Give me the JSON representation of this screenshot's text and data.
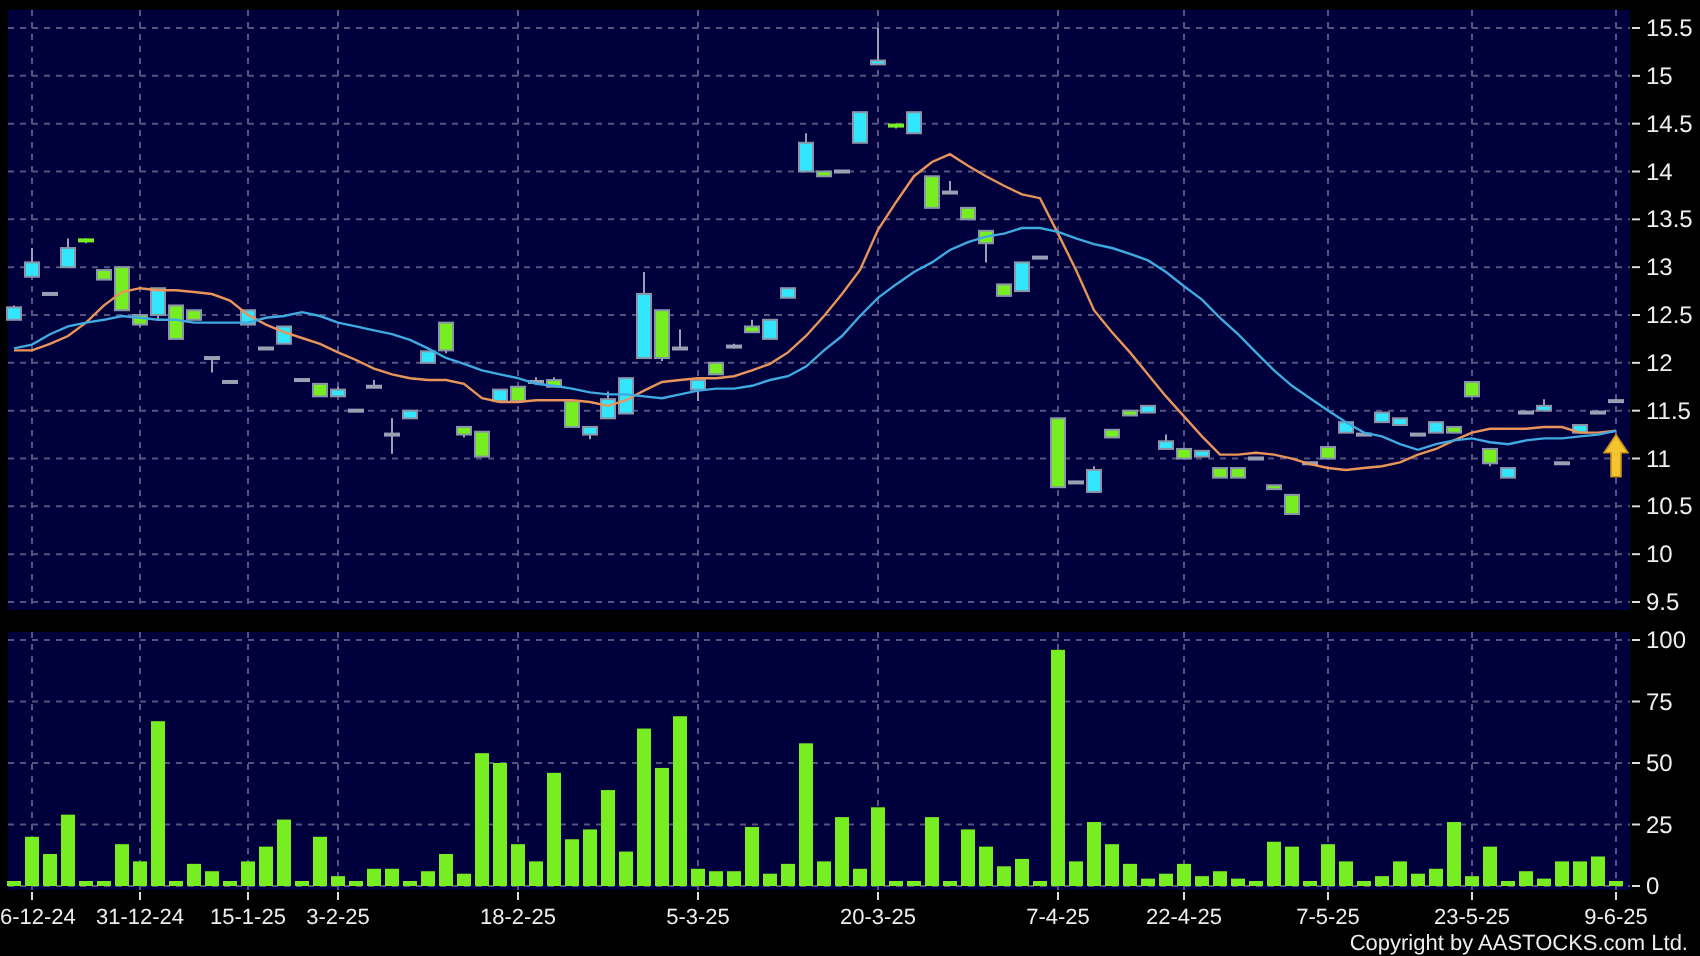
{
  "price_chart": {
    "chart_data": {
      "type": "candlestick",
      "grid": true,
      "ylim": [
        9.5,
        15.5
      ],
      "yticks": [
        9.5,
        10,
        10.5,
        11,
        11.5,
        12,
        12.5,
        13,
        13.5,
        14,
        14.5,
        15,
        15.5
      ],
      "ohlc": [
        [
          12.45,
          12.6,
          12.45,
          12.58
        ],
        [
          12.9,
          13.2,
          12.9,
          13.05
        ],
        [
          12.72,
          12.72,
          12.72,
          12.72
        ],
        [
          13.0,
          13.3,
          13.0,
          13.2
        ],
        [
          13.28,
          13.3,
          13.25,
          13.25
        ],
        [
          12.97,
          12.97,
          12.87,
          12.87
        ],
        [
          13.0,
          13.0,
          12.55,
          12.55
        ],
        [
          12.5,
          12.5,
          12.38,
          12.4
        ],
        [
          12.5,
          12.78,
          12.45,
          12.78
        ],
        [
          12.6,
          12.6,
          12.25,
          12.25
        ],
        [
          12.55,
          12.55,
          12.45,
          12.45
        ],
        [
          12.05,
          12.05,
          11.9,
          12.05
        ],
        [
          11.8,
          11.8,
          11.8,
          11.8
        ],
        [
          12.4,
          12.55,
          12.4,
          12.55
        ],
        [
          12.15,
          12.15,
          12.15,
          12.15
        ],
        [
          12.2,
          12.38,
          12.2,
          12.38
        ],
        [
          11.82,
          11.82,
          11.82,
          11.82
        ],
        [
          11.78,
          11.78,
          11.65,
          11.65
        ],
        [
          11.65,
          11.75,
          11.65,
          11.72
        ],
        [
          11.5,
          11.5,
          11.5,
          11.5
        ],
        [
          11.75,
          11.82,
          11.75,
          11.75
        ],
        [
          11.25,
          11.42,
          11.05,
          11.25
        ],
        [
          11.42,
          11.5,
          11.42,
          11.5
        ],
        [
          12.0,
          12.12,
          12.0,
          12.12
        ],
        [
          12.42,
          12.42,
          12.1,
          12.13
        ],
        [
          11.33,
          11.33,
          11.22,
          11.25
        ],
        [
          11.28,
          11.28,
          11.02,
          11.02
        ],
        [
          11.6,
          11.72,
          11.6,
          11.72
        ],
        [
          11.75,
          11.75,
          11.58,
          11.6
        ],
        [
          11.8,
          11.85,
          11.8,
          11.8
        ],
        [
          11.82,
          11.85,
          11.75,
          11.75
        ],
        [
          11.6,
          11.6,
          11.33,
          11.33
        ],
        [
          11.25,
          11.33,
          11.2,
          11.33
        ],
        [
          11.42,
          11.7,
          11.42,
          11.62
        ],
        [
          11.47,
          11.84,
          11.47,
          11.84
        ],
        [
          12.05,
          12.95,
          12.05,
          12.72
        ],
        [
          12.55,
          12.55,
          12.02,
          12.05
        ],
        [
          12.15,
          12.35,
          12.15,
          12.15
        ],
        [
          11.72,
          11.82,
          11.6,
          11.82
        ],
        [
          12.0,
          12.0,
          11.88,
          11.88
        ],
        [
          12.17,
          12.2,
          12.15,
          12.17
        ],
        [
          12.38,
          12.45,
          12.32,
          12.32
        ],
        [
          12.25,
          12.45,
          12.25,
          12.45
        ],
        [
          12.68,
          12.78,
          12.68,
          12.78
        ],
        [
          14.0,
          14.4,
          14.0,
          14.3
        ],
        [
          14.0,
          14.0,
          13.95,
          13.95
        ],
        [
          14.0,
          14.0,
          14.0,
          14.0
        ],
        [
          14.3,
          14.62,
          14.3,
          14.62
        ],
        [
          15.12,
          15.5,
          15.12,
          15.16
        ],
        [
          14.48,
          14.5,
          14.45,
          14.45
        ],
        [
          14.4,
          14.62,
          14.4,
          14.62
        ],
        [
          13.95,
          13.95,
          13.62,
          13.62
        ],
        [
          13.78,
          13.9,
          13.78,
          13.78
        ],
        [
          13.62,
          13.62,
          13.5,
          13.5
        ],
        [
          13.38,
          13.38,
          13.05,
          13.25
        ],
        [
          12.82,
          12.82,
          12.7,
          12.7
        ],
        [
          12.75,
          13.05,
          12.75,
          13.05
        ],
        [
          13.1,
          13.1,
          13.1,
          13.1
        ],
        [
          11.42,
          11.42,
          10.7,
          10.7
        ],
        [
          10.75,
          10.75,
          10.75,
          10.75
        ],
        [
          10.65,
          10.92,
          10.65,
          10.88
        ],
        [
          11.3,
          11.3,
          11.22,
          11.22
        ],
        [
          11.5,
          11.5,
          11.45,
          11.45
        ],
        [
          11.48,
          11.55,
          11.48,
          11.55
        ],
        [
          11.1,
          11.25,
          11.1,
          11.18
        ],
        [
          11.1,
          11.1,
          11.0,
          11.0
        ],
        [
          11.02,
          11.08,
          11.02,
          11.08
        ],
        [
          10.9,
          10.9,
          10.8,
          10.8
        ],
        [
          10.9,
          10.9,
          10.8,
          10.8
        ],
        [
          11.0,
          11.0,
          11.0,
          11.0
        ],
        [
          10.72,
          10.72,
          10.68,
          10.68
        ],
        [
          10.62,
          10.62,
          10.42,
          10.42
        ],
        [
          10.95,
          10.95,
          10.95,
          10.95
        ],
        [
          11.12,
          11.12,
          11.0,
          11.0
        ],
        [
          11.27,
          11.38,
          11.27,
          11.38
        ],
        [
          11.25,
          11.25,
          11.25,
          11.25
        ],
        [
          11.38,
          11.48,
          11.38,
          11.48
        ],
        [
          11.35,
          11.42,
          11.35,
          11.42
        ],
        [
          11.25,
          11.25,
          11.25,
          11.25
        ],
        [
          11.27,
          11.38,
          11.27,
          11.38
        ],
        [
          11.33,
          11.33,
          11.27,
          11.27
        ],
        [
          11.8,
          11.8,
          11.65,
          11.65
        ],
        [
          11.1,
          11.1,
          10.92,
          10.95
        ],
        [
          10.8,
          10.9,
          10.8,
          10.9
        ],
        [
          11.48,
          11.48,
          11.48,
          11.48
        ],
        [
          11.5,
          11.62,
          11.5,
          11.55
        ],
        [
          10.95,
          10.95,
          10.95,
          10.95
        ],
        [
          11.27,
          11.35,
          11.27,
          11.35
        ],
        [
          11.48,
          11.5,
          11.48,
          11.48
        ],
        [
          11.6,
          11.6,
          11.6,
          11.6
        ]
      ],
      "series": [
        {
          "type": "line",
          "color": "#e8945a",
          "values": [
            12.13,
            12.13,
            12.2,
            12.28,
            12.42,
            12.6,
            12.74,
            12.78,
            12.76,
            12.76,
            12.74,
            12.72,
            12.65,
            12.5,
            12.4,
            12.32,
            12.26,
            12.2,
            12.11,
            12.03,
            11.94,
            11.88,
            11.84,
            11.82,
            11.82,
            11.78,
            11.63,
            11.59,
            11.59,
            11.61,
            11.61,
            11.61,
            11.59,
            11.55,
            11.61,
            11.71,
            11.8,
            11.82,
            11.84,
            11.84,
            11.86,
            11.92,
            11.99,
            12.11,
            12.28,
            12.49,
            12.72,
            12.97,
            13.39,
            13.68,
            13.95,
            14.1,
            14.18,
            14.06,
            13.95,
            13.85,
            13.76,
            13.72,
            13.35,
            12.97,
            12.55,
            12.32,
            12.11,
            11.88,
            11.65,
            11.44,
            11.23,
            11.04,
            11.04,
            11.06,
            11.04,
            11.0,
            10.94,
            10.9,
            10.88,
            10.9,
            10.92,
            10.96,
            11.04,
            11.1,
            11.19,
            11.27,
            11.31,
            11.31,
            11.31,
            11.33,
            11.33,
            11.27,
            11.27,
            11.29
          ]
        },
        {
          "type": "line",
          "color": "#3fa9e0",
          "values": [
            12.15,
            12.19,
            12.3,
            12.38,
            12.42,
            12.45,
            12.49,
            12.47,
            12.45,
            12.45,
            12.42,
            12.42,
            12.42,
            12.42,
            12.47,
            12.49,
            12.53,
            12.49,
            12.42,
            12.38,
            12.34,
            12.3,
            12.24,
            12.15,
            12.05,
            11.99,
            11.92,
            11.88,
            11.84,
            11.78,
            11.76,
            11.73,
            11.69,
            11.67,
            11.67,
            11.65,
            11.63,
            11.67,
            11.71,
            11.73,
            11.73,
            11.76,
            11.82,
            11.86,
            11.96,
            12.13,
            12.28,
            12.49,
            12.68,
            12.82,
            12.95,
            13.05,
            13.18,
            13.26,
            13.32,
            13.35,
            13.41,
            13.41,
            13.37,
            13.3,
            13.24,
            13.2,
            13.14,
            13.07,
            12.95,
            12.8,
            12.66,
            12.47,
            12.3,
            12.11,
            11.92,
            11.76,
            11.63,
            11.5,
            11.38,
            11.27,
            11.23,
            11.15,
            11.09,
            11.15,
            11.19,
            11.21,
            11.17,
            11.15,
            11.19,
            11.21,
            11.21,
            11.23,
            11.25,
            11.29
          ]
        }
      ]
    }
  },
  "volume_chart": {
    "chart_data": {
      "type": "bar",
      "grid": true,
      "ylim": [
        0,
        100
      ],
      "yticks": [
        0,
        25,
        50,
        75,
        100
      ],
      "categories": [
        null,
        "6-12-24",
        null,
        null,
        null,
        null,
        null,
        "31-12-24",
        null,
        null,
        null,
        null,
        null,
        "15-1-25",
        null,
        null,
        null,
        null,
        "3-2-25",
        null,
        null,
        null,
        null,
        null,
        null,
        null,
        null,
        null,
        "18-2-25",
        null,
        null,
        null,
        null,
        null,
        null,
        null,
        null,
        null,
        "5-3-25",
        null,
        null,
        null,
        null,
        null,
        null,
        null,
        null,
        null,
        "20-3-25",
        null,
        null,
        null,
        null,
        null,
        null,
        null,
        null,
        null,
        "7-4-25",
        null,
        null,
        null,
        null,
        null,
        null,
        "22-4-25",
        null,
        null,
        null,
        null,
        null,
        null,
        null,
        "7-5-25",
        null,
        null,
        null,
        null,
        null,
        null,
        null,
        "23-5-25",
        null,
        null,
        null,
        null,
        null,
        null,
        null,
        "9-6-25"
      ],
      "values": [
        1,
        20,
        13,
        29,
        2,
        0,
        17,
        10,
        67,
        0,
        9,
        6,
        2,
        10,
        16,
        27,
        1,
        20,
        4,
        2,
        7,
        7,
        0,
        6,
        13,
        5,
        54,
        50,
        17,
        10,
        46,
        19,
        23,
        39,
        14,
        64,
        48,
        69,
        7,
        6,
        6,
        24,
        5,
        9,
        58,
        10,
        28,
        7,
        32,
        1,
        0,
        28,
        0,
        23,
        16,
        8,
        11,
        1,
        96,
        10,
        26,
        17,
        9,
        3,
        5,
        9,
        4,
        6,
        3,
        2,
        18,
        16,
        2,
        17,
        10,
        0,
        4,
        10,
        5,
        7,
        26,
        4,
        16,
        2,
        6,
        3,
        10,
        10,
        12,
        2
      ]
    }
  },
  "copyright": "Copyright by AASTOCKS.com Ltd."
}
